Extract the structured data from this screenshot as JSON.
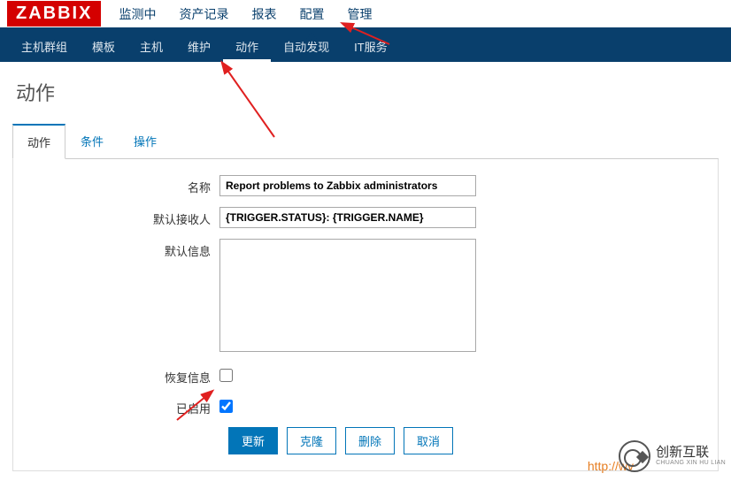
{
  "logo": "ZABBIX",
  "topnav": [
    {
      "label": "监测中"
    },
    {
      "label": "资产记录"
    },
    {
      "label": "报表"
    },
    {
      "label": "配置",
      "active": true
    },
    {
      "label": "管理"
    }
  ],
  "subnav": [
    {
      "label": "主机群组"
    },
    {
      "label": "模板"
    },
    {
      "label": "主机"
    },
    {
      "label": "维护"
    },
    {
      "label": "动作",
      "active": true
    },
    {
      "label": "自动发现"
    },
    {
      "label": "IT服务"
    }
  ],
  "page_title": "动作",
  "tabs": [
    {
      "label": "动作",
      "active": true
    },
    {
      "label": "条件"
    },
    {
      "label": "操作"
    }
  ],
  "form": {
    "name_label": "名称",
    "name_value": "Report problems to Zabbix administrators",
    "default_recipient_label": "默认接收人",
    "default_recipient_value": "{TRIGGER.STATUS}: {TRIGGER.NAME}",
    "default_message_label": "默认信息",
    "default_message_value": "",
    "recovery_message_label": "恢复信息",
    "recovery_message_checked": false,
    "enabled_label": "已启用",
    "enabled_checked": true
  },
  "buttons": {
    "update": "更新",
    "clone": "克隆",
    "delete": "删除",
    "cancel": "取消"
  },
  "footer_link": "http://wv",
  "watermark": {
    "title": "创新互联",
    "sub": "CHUANG XIN HU LIAN"
  },
  "annotation_arrow_color": "#e02020"
}
